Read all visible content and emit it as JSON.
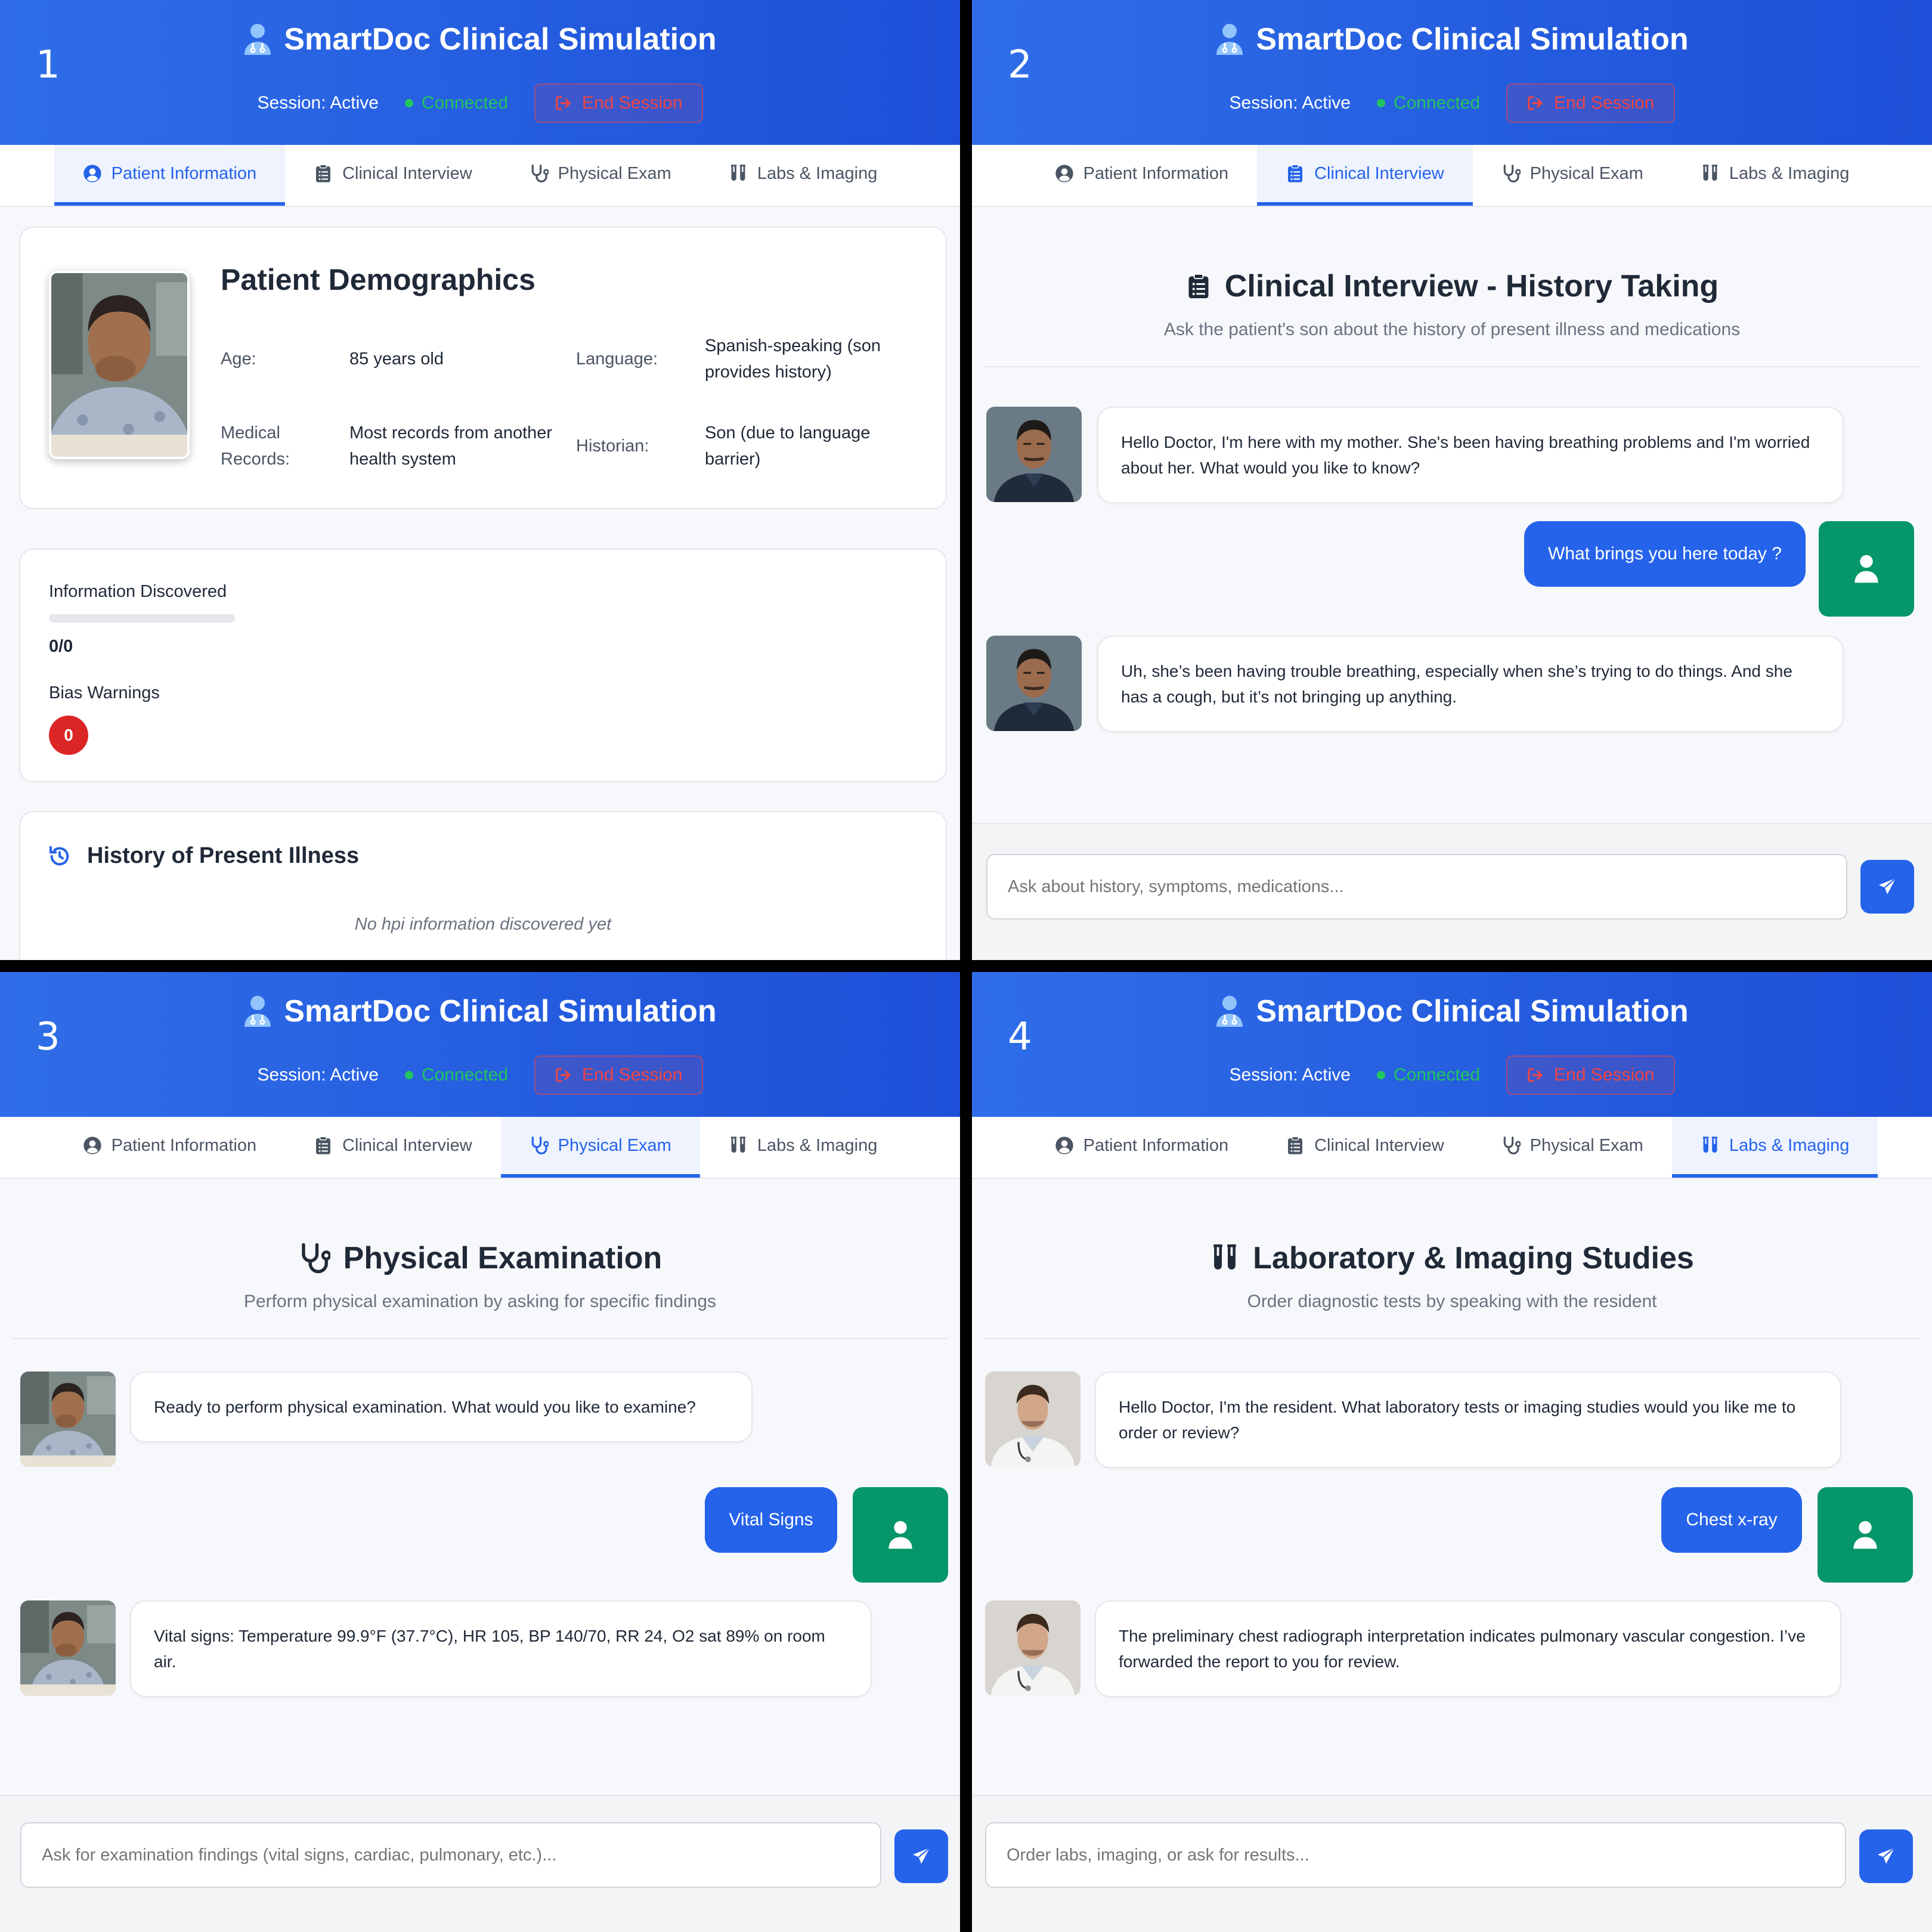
{
  "app": {
    "title": "SmartDoc Clinical Simulation",
    "session_status": "Session: Active",
    "connection": "Connected",
    "end_session": "End Session"
  },
  "tabs": [
    {
      "label": "Patient Information",
      "icon": "user-circle-icon"
    },
    {
      "label": "Clinical Interview",
      "icon": "clipboard-icon"
    },
    {
      "label": "Physical Exam",
      "icon": "stethoscope-icon"
    },
    {
      "label": "Labs & Imaging",
      "icon": "test-tubes-icon"
    }
  ],
  "panels": [
    {
      "number": "1",
      "active_tab": 0
    },
    {
      "number": "2",
      "active_tab": 1
    },
    {
      "number": "3",
      "active_tab": 2
    },
    {
      "number": "4",
      "active_tab": 3
    }
  ],
  "patient": {
    "demographics_title": "Patient Demographics",
    "age_label": "Age:",
    "age_value": "85 years old",
    "language_label": "Language:",
    "language_value": "Spanish-speaking (son provides history)",
    "records_label": "Medical Records:",
    "records_value": "Most records from another health system",
    "historian_label": "Historian:",
    "historian_value": "Son (due to language barrier)",
    "info_discovered_label": "Information Discovered",
    "info_discovered_value": "0/0",
    "info_discovered_fraction": 0,
    "bias_warnings_label": "Bias Warnings",
    "bias_warnings_count": "0",
    "hpi_title": "History of Present Illness",
    "hpi_empty": "No hpi information discovered yet"
  },
  "interview": {
    "title": "Clinical Interview - History Taking",
    "subtitle": "Ask the patient's son about the history of present illness and medications",
    "messages": [
      {
        "role": "son",
        "text": "Hello Doctor, I'm here with my mother. She's been having breathing problems and I'm worried about her. What would you like to know?"
      },
      {
        "role": "doctor",
        "text": "What brings you here today ?"
      },
      {
        "role": "son",
        "text": "Uh, she’s been having trouble breathing, especially when she’s trying to do things. And she has a cough, but it’s not bringing up anything."
      }
    ],
    "placeholder": "Ask about history, symptoms, medications..."
  },
  "exam": {
    "title": "Physical Examination",
    "subtitle": "Perform physical examination by asking for specific findings",
    "messages": [
      {
        "role": "patient",
        "text": "Ready to perform physical examination. What would you like to examine?"
      },
      {
        "role": "doctor",
        "text": "Vital Signs"
      },
      {
        "role": "patient",
        "text": "Vital signs: Temperature 99.9°F (37.7°C), HR 105, BP 140/70, RR 24, O2 sat 89% on room air."
      }
    ],
    "placeholder": "Ask for examination findings (vital signs, cardiac, pulmonary, etc.)..."
  },
  "labs": {
    "title": "Laboratory & Imaging Studies",
    "subtitle": "Order diagnostic tests by speaking with the resident",
    "messages": [
      {
        "role": "resident",
        "text": "Hello Doctor, I'm the resident. What laboratory tests or imaging studies would you like me to order or review?"
      },
      {
        "role": "doctor",
        "text": "Chest x-ray"
      },
      {
        "role": "resident",
        "text": "The preliminary chest radiograph interpretation indicates pulmonary vascular congestion. I’ve forwarded the report to you for review."
      }
    ],
    "placeholder": "Order labs, imaging, or ask for results..."
  },
  "colors": {
    "header": "#1d4fd8",
    "accent": "#2563eb",
    "connected": "#22c55e",
    "danger": "#dc2626",
    "doctor_avatar": "#059669"
  }
}
